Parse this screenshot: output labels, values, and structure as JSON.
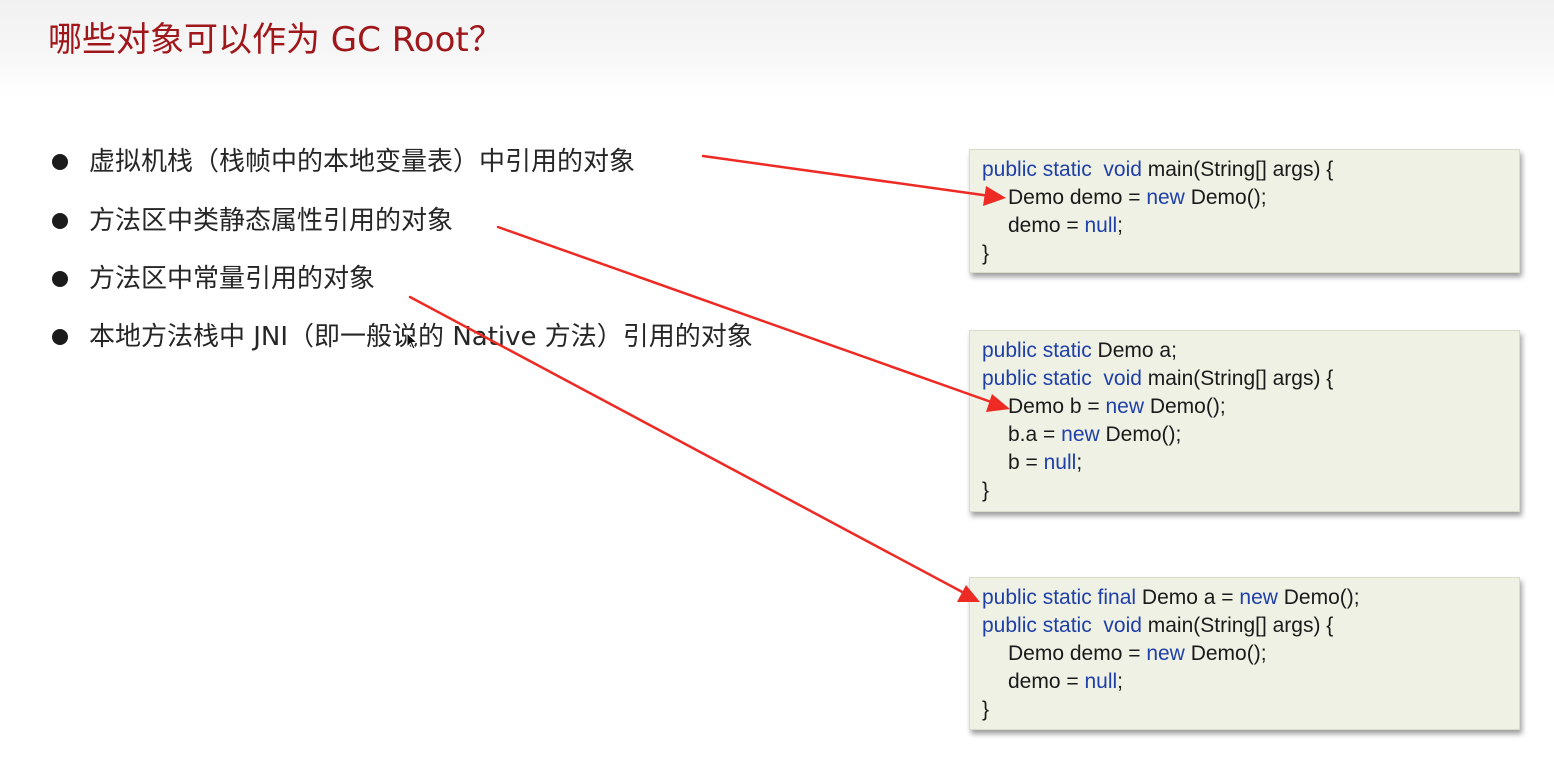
{
  "header": {
    "title": "哪些对象可以作为 GC Root？"
  },
  "bullets": [
    "虚拟机栈（栈帧中的本地变量表）中引用的对象",
    "方法区中类静态属性引用的对象",
    "方法区中常量引用的对象",
    "本地方法栈中 JNI（即一般说的 Native 方法）引用的对象"
  ],
  "code_blocks": {
    "stack": {
      "l1": {
        "kw": "public static  void",
        "rest": " main(String[] args) {"
      },
      "l2": {
        "a": "Demo demo = ",
        "kw": "new",
        "b": " Demo();"
      },
      "l3": {
        "a": "demo = ",
        "kw": "null",
        "b": ";"
      },
      "l4": "}"
    },
    "static_field": {
      "l1": {
        "kw": "public static",
        "rest": " Demo a;"
      },
      "l2": {
        "kw": "public static  void",
        "rest": " main(String[] args) {"
      },
      "l3": {
        "a": "Demo b = ",
        "kw": "new",
        "b": " Demo();"
      },
      "l4": {
        "a": "b.a = ",
        "kw": "new",
        "b": " Demo();"
      },
      "l5": {
        "a": "b = ",
        "kw": "null",
        "b": ";"
      },
      "l6": "}"
    },
    "constant": {
      "l1": {
        "kw": "public static final",
        "a": " Demo a = ",
        "kw2": "new",
        "b": " Demo();"
      },
      "l2": {
        "kw": "public static  void",
        "rest": " main(String[] args) {"
      },
      "l3": {
        "a": "Demo demo = ",
        "kw": "new",
        "b": " Demo();"
      },
      "l4": {
        "a": "demo = ",
        "kw": "null",
        "b": ";"
      },
      "l5": "}"
    }
  },
  "colors": {
    "title": "#a0171b",
    "keyword": "#1f3fa8",
    "arrow": "#ee2a24",
    "code_bg": "#eef1e4"
  }
}
